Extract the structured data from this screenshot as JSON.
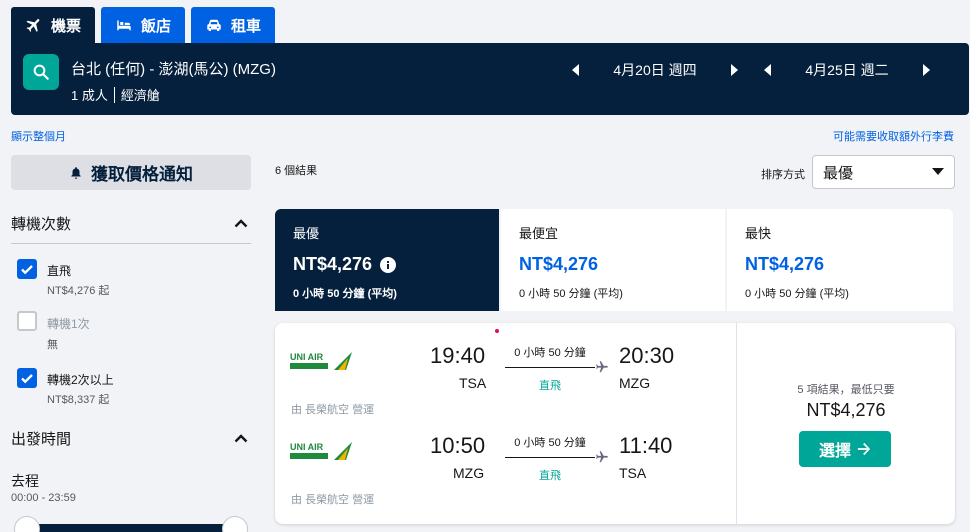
{
  "tabs": [
    {
      "label": "機票",
      "icon": "plane-icon",
      "active": true
    },
    {
      "label": "飯店",
      "icon": "bed-icon",
      "active": false
    },
    {
      "label": "租車",
      "icon": "car-icon",
      "active": false
    }
  ],
  "search": {
    "route": "台北 (任何) - 澎湖(馬公) (MZG)",
    "passengers": "1 成人",
    "cabin": "經濟艙",
    "depart_date": "4月20日 週四",
    "return_date": "4月25日 週二"
  },
  "links": {
    "show_month": "顯示整個月",
    "baggage_fees": "可能需要收取額外行李費"
  },
  "sidebar": {
    "price_alert": "獲取價格通知",
    "stops_title": "轉機次數",
    "stops": [
      {
        "label": "直飛",
        "price": "NT$4,276 起",
        "checked": true,
        "disabled": false
      },
      {
        "label": "轉機1次",
        "price": "無",
        "checked": false,
        "disabled": true
      },
      {
        "label": "轉機2次以上",
        "price": "NT$8,337 起",
        "checked": true,
        "disabled": false
      }
    ],
    "departure_title": "出發時間",
    "outbound_label": "去程",
    "outbound_range": "00:00 - 23:59"
  },
  "results": {
    "count": "6 個結果",
    "sort_label": "排序方式",
    "sort_value": "最優"
  },
  "sort_tabs": [
    {
      "label": "最優",
      "price": "NT$4,276",
      "duration": "0 小時 50 分鐘 (平均)",
      "active": true
    },
    {
      "label": "最便宜",
      "price": "NT$4,276",
      "duration": "0 小時 50 分鐘 (平均)",
      "active": false
    },
    {
      "label": "最快",
      "price": "NT$4,276",
      "duration": "0 小時 50 分鐘 (平均)",
      "active": false
    }
  ],
  "flight": {
    "legs": [
      {
        "dep_time": "19:40",
        "dep_code": "TSA",
        "duration": "0 小時 50 分鐘",
        "stops": "直飛",
        "arr_time": "20:30",
        "arr_code": "MZG",
        "operator": "由 長榮航空 營運"
      },
      {
        "dep_time": "10:50",
        "dep_code": "MZG",
        "duration": "0 小時 50 分鐘",
        "stops": "直飛",
        "arr_time": "11:40",
        "arr_code": "TSA",
        "operator": "由 長榮航空 營運"
      }
    ],
    "deal_count": "5 項結果，最低只要",
    "price": "NT$4,276",
    "select_label": "選擇"
  },
  "colors": {
    "navy": "#05203c",
    "blue": "#0062e3",
    "teal": "#00a698",
    "uniair_green": "#1e8a3c"
  }
}
